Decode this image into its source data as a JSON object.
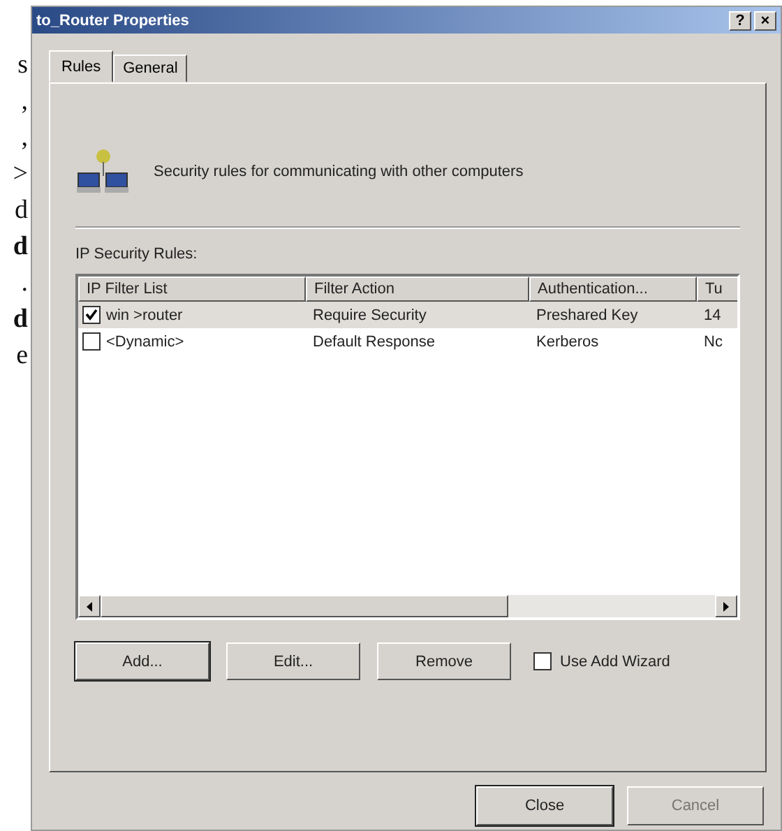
{
  "margin_fragments": [
    {
      "text": "s",
      "bold": false
    },
    {
      "text": ",",
      "bold": false
    },
    {
      "text": ",",
      "bold": false
    },
    {
      "text": ">",
      "bold": false
    },
    {
      "text": "d",
      "bold": false
    },
    {
      "text": "d",
      "bold": true
    },
    {
      "text": ".",
      "bold": false
    },
    {
      "text": "d",
      "bold": true
    },
    {
      "text": "e",
      "bold": false
    }
  ],
  "window": {
    "title": "to_Router Properties",
    "help": "?",
    "close": "×"
  },
  "tabs": [
    {
      "label": "Rules",
      "selected": true
    },
    {
      "label": "General",
      "selected": false
    }
  ],
  "description": "Security rules for communicating with other computers",
  "rules_label": "IP Security Rules:",
  "table": {
    "columns": [
      "IP Filter List",
      "Filter Action",
      "Authentication...",
      "Tu"
    ],
    "rows": [
      {
        "checked": true,
        "selected": true,
        "cells": [
          "win >router",
          "Require Security",
          "Preshared Key",
          "14"
        ]
      },
      {
        "checked": false,
        "selected": false,
        "cells": [
          "<Dynamic>",
          "Default Response",
          "Kerberos",
          "Nc"
        ]
      }
    ]
  },
  "buttons": [
    {
      "label": "Add...",
      "focused": true
    },
    {
      "label": "Edit...",
      "focused": false
    },
    {
      "label": "Remove",
      "focused": false
    }
  ],
  "use_add_wizard": {
    "label": "Use Add Wizard",
    "checked": false
  },
  "footer_buttons": [
    {
      "label": "Close",
      "disabled": false,
      "default": true
    },
    {
      "label": "Cancel",
      "disabled": true,
      "default": false
    }
  ]
}
